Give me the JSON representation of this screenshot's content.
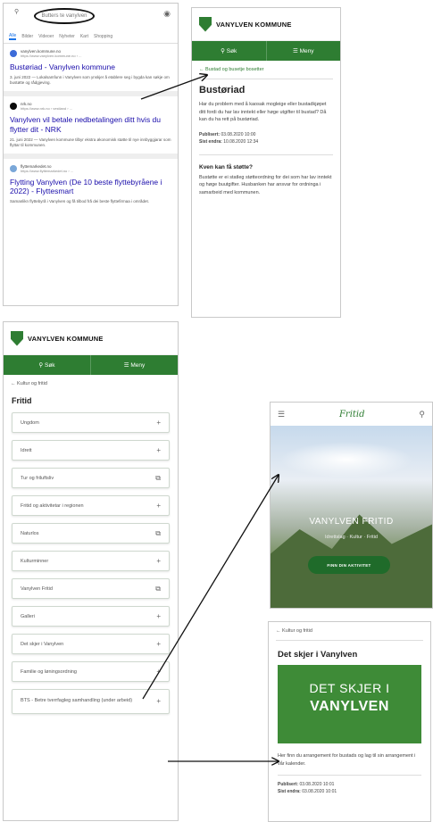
{
  "search": {
    "query": "Butters te vanylven",
    "tabs": [
      "Alle",
      "Bilder",
      "Videoer",
      "Nyheter",
      "Kart",
      "Shopping"
    ],
    "results": [
      {
        "site": "vanylven.kommune.no",
        "url": "https://www.vanylven.kommune.no › ...",
        "title": "Bustøriad - Vanylven kommune",
        "snippet": "3. juni 2022 — Lokalsamfunn i Vanylven som ynskjer å etablere seg i bygda kan søkje om bustøtte og rådgjeving."
      },
      {
        "site": "nrk.no",
        "url": "https://www.nrk.no › vestland › ...",
        "title": "Vanylven vil betale nedbetalingen ditt hvis du flytter dit - NRK",
        "snippet": "21. juni 2022 — Vanylven kommune tilbyr ekstra økonomisk støtte til nye innbyggjarar som flyttar til kommunen."
      },
      {
        "site": "flyttemarkedet.no",
        "url": "https://www.flyttemarkedet.no › ...",
        "title": "Flytting Vanylven (De 10 beste flyttebyråene i 2022) - Flyttesmart",
        "snippet": "Samanlikn flyttebyrå i Vanylven og få tilbod frå dei beste flyttefirmaa i området."
      }
    ]
  },
  "kommune": {
    "name": "VANYLVEN KOMMUNE",
    "search_label": "Søk",
    "menu_label": "Meny"
  },
  "article": {
    "breadcrumb": "Bustad og busetje bosetter",
    "title": "Bustøriad",
    "body": "Har du problem med å kaosak mogleige eller bustadkjøpet ditt fordi du har lav inntekt eller høge utgifter til bustad? Då kan du ha rett på bustøriad.",
    "published_label": "Publisert:",
    "published": "03.08.2020 10:00",
    "edited_label": "Sist endra:",
    "edited": "10.08.2020 12:34",
    "sub_title": "Kven kan få støtte?",
    "sub_body": "Bustøtte er ei statleg støtteordning for dei som har lav inntekt og høge buutgifter. Husbanken har ansvar for ordninga i samarbeid med kommunen."
  },
  "fritid_page": {
    "breadcrumb": "Kultur og fritid",
    "title": "Fritid",
    "items": [
      {
        "label": "Ungdom",
        "icon": "plus"
      },
      {
        "label": "Idrett",
        "icon": "plus"
      },
      {
        "label": "Tur og friluftsliv",
        "icon": "external"
      },
      {
        "label": "Fritid og aktivitetar i regionen",
        "icon": "plus"
      },
      {
        "label": "Naturlos",
        "icon": "external"
      },
      {
        "label": "Kulturminner",
        "icon": "plus"
      },
      {
        "label": "Vanylven Fritid",
        "icon": "external"
      },
      {
        "label": "Galleri",
        "icon": "plus"
      },
      {
        "label": "Det skjer i Vanylven",
        "icon": "plus"
      },
      {
        "label": "Familie og løningsordning",
        "icon": "plus"
      },
      {
        "label": "BTS - Betre tverrfagleg samhandling (under arbeid)",
        "icon": "plus"
      }
    ]
  },
  "fritid_site": {
    "logo": "Fritid",
    "title": "VANYLVEN FRITID",
    "subtitle": "Idrettslag · Kultur · Fritid",
    "button": "FINN DIN AKTIVITET"
  },
  "detskjer": {
    "breadcrumb": "Kultur og fritid",
    "title": "Det skjer i Vanylven",
    "banner_line1": "DET SKJER I",
    "banner_line2": "VANYLVEN",
    "body": "Her finn du arrangement for bustads og lag til sin arrangement i vår kalender.",
    "published_label": "Publisert:",
    "published": "03.08.2020 10:01",
    "edited_label": "Sist endra:",
    "edited": "03.08.2020 10:01"
  },
  "colors": {
    "accent": "#2e7d32",
    "link": "#1a0dab"
  }
}
